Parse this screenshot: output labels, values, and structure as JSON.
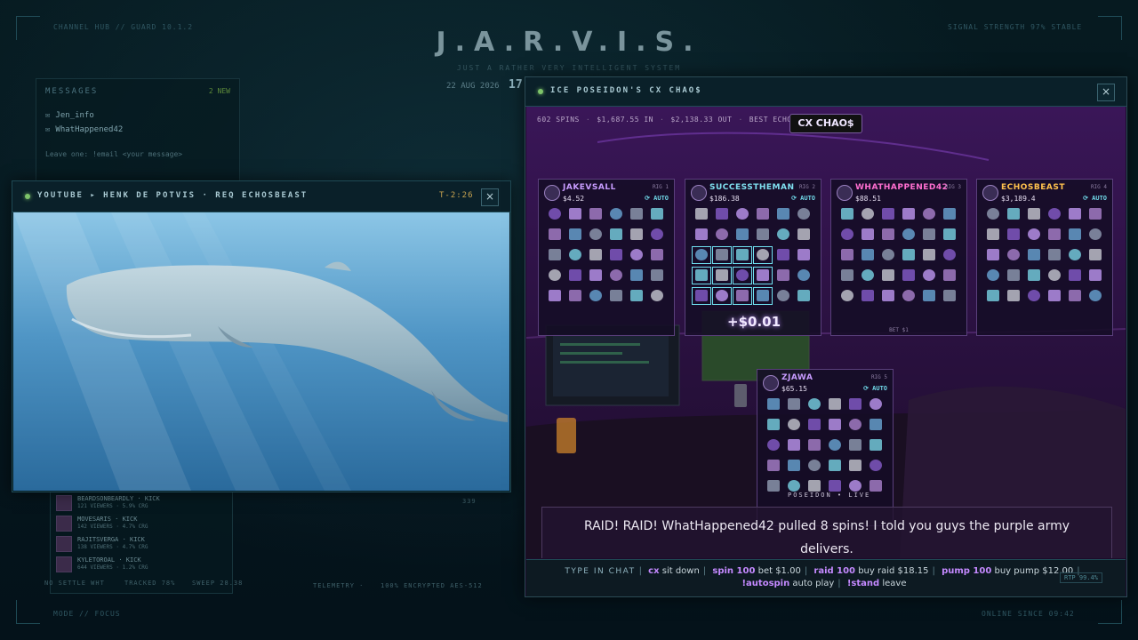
{
  "hud": {
    "title": "J.A.R.V.I.S.",
    "subtitle": "JUST A RATHER VERY INTELLIGENT SYSTEM",
    "date": "22 AUG 2026",
    "time": "17",
    "top_left": "CHANNEL HUB // GUARD 10.1.2",
    "top_right": "SIGNAL STRENGTH 97% STABLE",
    "bottom_left": "MODE // FOCUS",
    "bottom_right": "ONLINE SINCE 09:42"
  },
  "messages": {
    "header": "MESSAGES",
    "new_count": "2 NEW",
    "items": [
      "Jen_info",
      "WhatHappened42"
    ],
    "hint": "Leave one: !email <your message>"
  },
  "streams": {
    "rows": [
      {
        "name": "BEARDSONBEARDLY · KICK",
        "viewers": "121 VIEWERS · 5.9% CRG"
      },
      {
        "name": "MOVESARIS · KICK",
        "viewers": "142 VIEWERS · 4.7% CRG"
      },
      {
        "name": "RAJITSVERGA · KICK",
        "viewers": "138 VIEWERS · 4.7% CRG"
      },
      {
        "name": "KYLETOROAL · KICK",
        "viewers": "644 VIEWERS · 1.2% CRG"
      }
    ],
    "foot_left": "NO SETTLE WHT",
    "foot_mid": "TRACKED 78%",
    "foot_right": "SWEEP 28.38"
  },
  "telemetry": {
    "label": "TELEMETRY ·",
    "encryption": "100% ENCRYPTED AES-512",
    "count": "339"
  },
  "youtube": {
    "title": "YOUTUBE ▸ HENK DE POTVIS · REQ ECHOSBEAST",
    "timer": "T-2:26",
    "close": "×"
  },
  "game": {
    "title": "ICE POSEIDON'S CX CHAO$",
    "close": "×",
    "badge": "CX CHAO$",
    "stats": {
      "spins": "602 SPINS",
      "in": "$1,687.55 IN",
      "out": "$2,138.33 OUT",
      "best": "BEST ECHOSBEAST"
    },
    "win_amount": "+$0.01",
    "live": "POSEIDON • LIVE",
    "raid": "RAID! RAID! WhatHappened42 pulled 8 spins! I told you guys the purple army delivers.",
    "rtp": "RTP 99.4%",
    "rigs": [
      {
        "name": "JAKEVSALL",
        "balance": "$4.52",
        "label": "RIG 1",
        "auto": "⟳ AUTO",
        "color": "#c89cff",
        "bet": ""
      },
      {
        "name": "SUCCESSTHEMAN",
        "balance": "$186.38",
        "label": "RIG 2",
        "auto": "⟳ AUTO",
        "color": "#7fe0f0",
        "bet": ""
      },
      {
        "name": "WHATHAPPENED42",
        "balance": "$88.51",
        "label": "RIG 3",
        "auto": "",
        "color": "#ff6fd0",
        "bet": "BET $1"
      },
      {
        "name": "ECHOSBEAST",
        "balance": "$3,189.4",
        "label": "RIG 4",
        "auto": "⟳ AUTO",
        "color": "#ffc24d",
        "bet": ""
      },
      {
        "name": "ZJAWA",
        "balance": "$65.15",
        "label": "RIG 5",
        "auto": "⟳ AUTO",
        "color": "#c89cff",
        "bet": ""
      }
    ],
    "chat": {
      "lead": "TYPE IN CHAT",
      "cmds": [
        {
          "cmd": "cx",
          "desc": "sit down"
        },
        {
          "cmd": "spin 100",
          "desc": "bet $1.00"
        },
        {
          "cmd": "raid 100",
          "desc": "buy raid $18.15"
        },
        {
          "cmd": "pump 100",
          "desc": "buy pump $12.00"
        },
        {
          "cmd": "!autospin",
          "desc": "auto play"
        },
        {
          "cmd": "!stand",
          "desc": "leave"
        }
      ]
    }
  },
  "colors": {
    "accent": "#6fd6e6",
    "purple": "#8b3cc8",
    "status_green": "#7ec46a"
  }
}
